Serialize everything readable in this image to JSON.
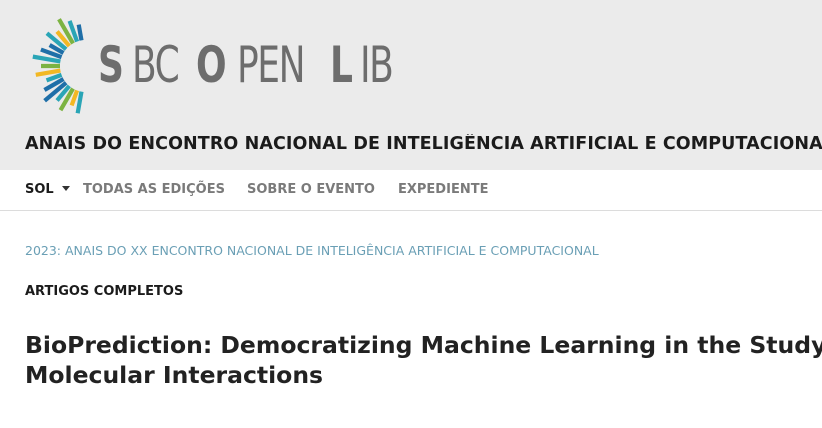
{
  "logo": {
    "text_parts": [
      "S",
      "BC",
      "O",
      "PEN",
      "L",
      "IB"
    ],
    "ray_colors": [
      "#1f6fa8",
      "#2aa5b6",
      "#7cb342",
      "#f2b824",
      "#2aa5b6",
      "#1f6fa8"
    ]
  },
  "header": {
    "site_title": "ANAIS DO ENCONTRO NACIONAL DE INTELIGÊNCIA ARTIFICIAL E COMPUTACIONAL (ENIAC)"
  },
  "nav": {
    "items": [
      {
        "label": "SOL"
      },
      {
        "label": "TODAS AS EDIÇÕES"
      },
      {
        "label": "SOBRE O EVENTO"
      },
      {
        "label": "EXPEDIENTE"
      }
    ]
  },
  "breadcrumb": "2023: ANAIS DO XX ENCONTRO NACIONAL DE INTELIGÊNCIA ARTIFICIAL E COMPUTACIONAL",
  "section": "ARTIGOS COMPLETOS",
  "article": {
    "title_line1": "BioPrediction: Democratizing Machine Learning in the Study of",
    "title_line2": "Molecular Interactions"
  }
}
